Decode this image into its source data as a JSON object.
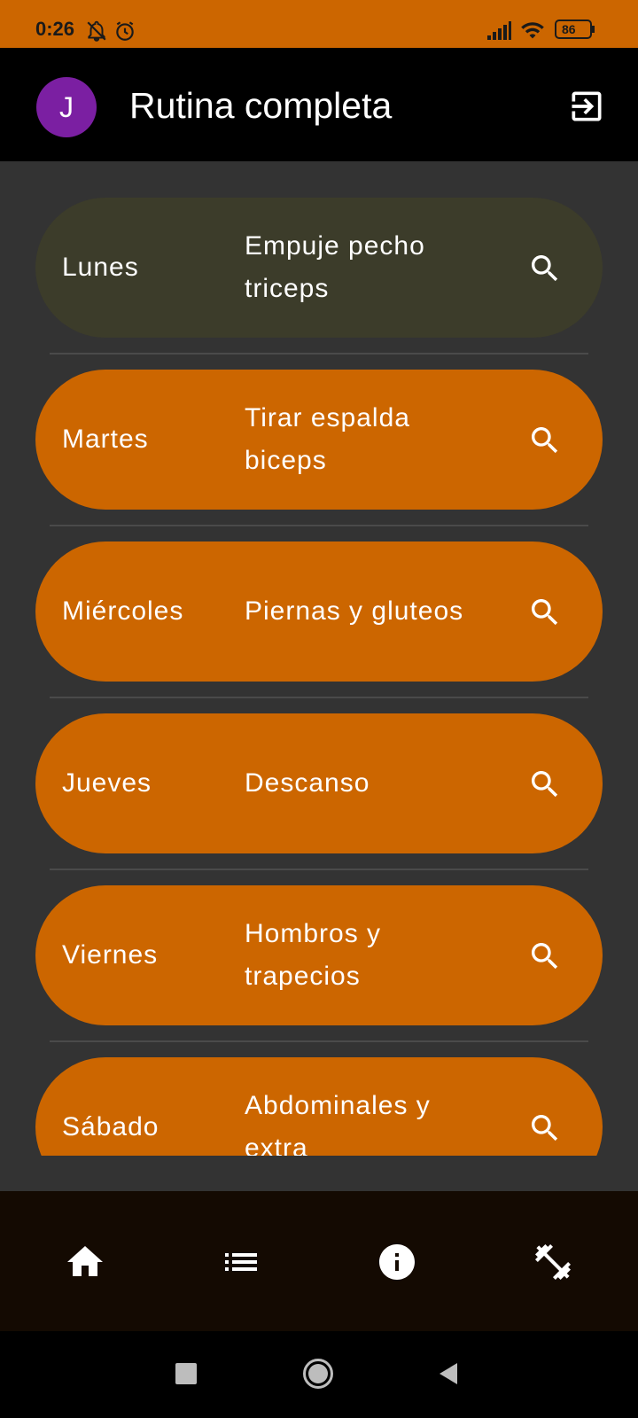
{
  "status_bar": {
    "time": "0:26",
    "battery": "86"
  },
  "app_bar": {
    "avatar_letter": "J",
    "title": "Rutina completa"
  },
  "routines": [
    {
      "day": "Lunes",
      "description": "Empuje pecho triceps"
    },
    {
      "day": "Martes",
      "description": "Tirar espalda biceps"
    },
    {
      "day": "Miércoles",
      "description": "Piernas y gluteos"
    },
    {
      "day": "Jueves",
      "description": "Descanso"
    },
    {
      "day": "Viernes",
      "description": "Hombros y trapecios"
    },
    {
      "day": "Sábado",
      "description": "Abdominales y extra"
    }
  ],
  "bottom_nav": [
    "home-icon",
    "list-icon",
    "info-icon",
    "dumbbell-icon"
  ],
  "colors": {
    "accent": "#cc6600",
    "first_row": "#3c3c2a",
    "avatar": "#7b1fa2",
    "background": "#333333"
  }
}
